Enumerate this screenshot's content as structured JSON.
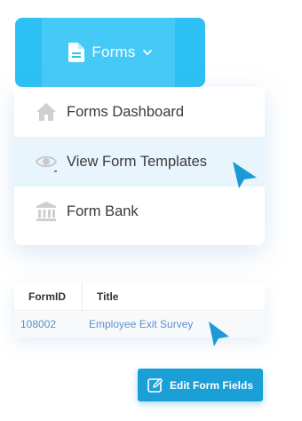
{
  "forms_button": {
    "label": "Forms",
    "icon": "document-icon",
    "chevron": "chevron-down-icon"
  },
  "menu": {
    "items": [
      {
        "label": "Forms Dashboard",
        "icon": "home-icon",
        "active": false
      },
      {
        "label": "View Form Templates",
        "icon": "eye-icon",
        "active": true
      },
      {
        "label": "Form Bank",
        "icon": "bank-icon",
        "active": false
      }
    ]
  },
  "table": {
    "columns": [
      "FormID",
      "Title"
    ],
    "rows": [
      {
        "form_id": "108002",
        "title": "Employee Exit Survey"
      }
    ]
  },
  "edit_button": {
    "label": "Edit Form Fields",
    "icon": "edit-icon"
  },
  "colors": {
    "accent": "#2cc0f4",
    "button": "#1a9fd6",
    "link": "#5b8fd0",
    "cursor": "#1b9ad6",
    "active_row": "#e8f5fc"
  }
}
